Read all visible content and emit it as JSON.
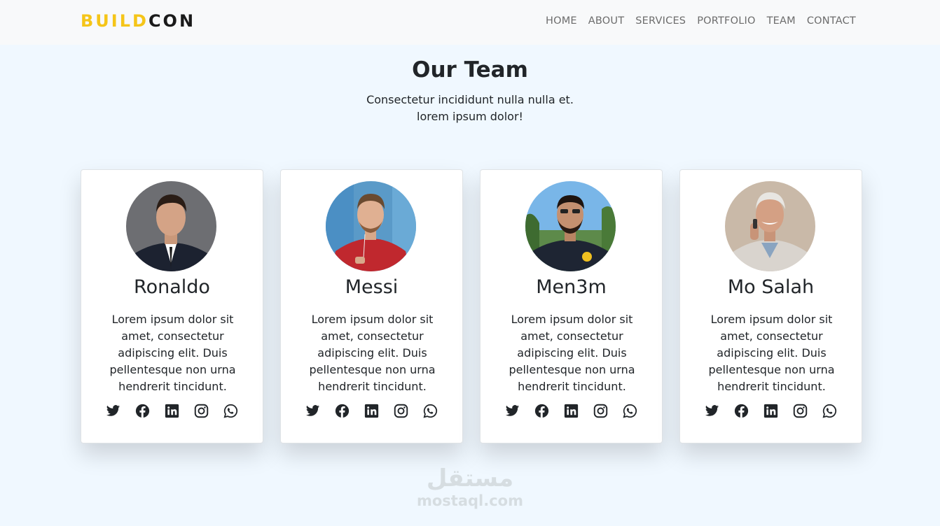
{
  "brand": {
    "part1": "BUILD",
    "part2": "CON",
    "accent_color": "#f5c518"
  },
  "nav": [
    "HOME",
    "ABOUT",
    "SERVICES",
    "PORTFOLIO",
    "TEAM",
    "CONTACT"
  ],
  "section": {
    "title": "Our Team",
    "subtitle_line1": "Consectetur incididunt nulla nulla et.",
    "subtitle_line2": "lorem ipsum dolor!"
  },
  "team": [
    {
      "name": "Ronaldo",
      "description": "Lorem ipsum dolor sit amet, consectetur adipiscing elit. Duis pellentesque non urna hendrerit tincidunt."
    },
    {
      "name": "Messi",
      "description": "Lorem ipsum dolor sit amet, consectetur adipiscing elit. Duis pellentesque non urna hendrerit tincidunt."
    },
    {
      "name": "Men3m",
      "description": "Lorem ipsum dolor sit amet, consectetur adipiscing elit. Duis pellentesque non urna hendrerit tincidunt."
    },
    {
      "name": "Mo Salah",
      "description": "Lorem ipsum dolor sit amet, consectetur adipiscing elit. Duis pellentesque non urna hendrerit tincidunt."
    }
  ],
  "social_icons": [
    "twitter-icon",
    "facebook-icon",
    "linkedin-icon",
    "instagram-icon",
    "whatsapp-icon"
  ],
  "watermark": {
    "arabic": "مستقل",
    "latin": "mostaql.com"
  }
}
